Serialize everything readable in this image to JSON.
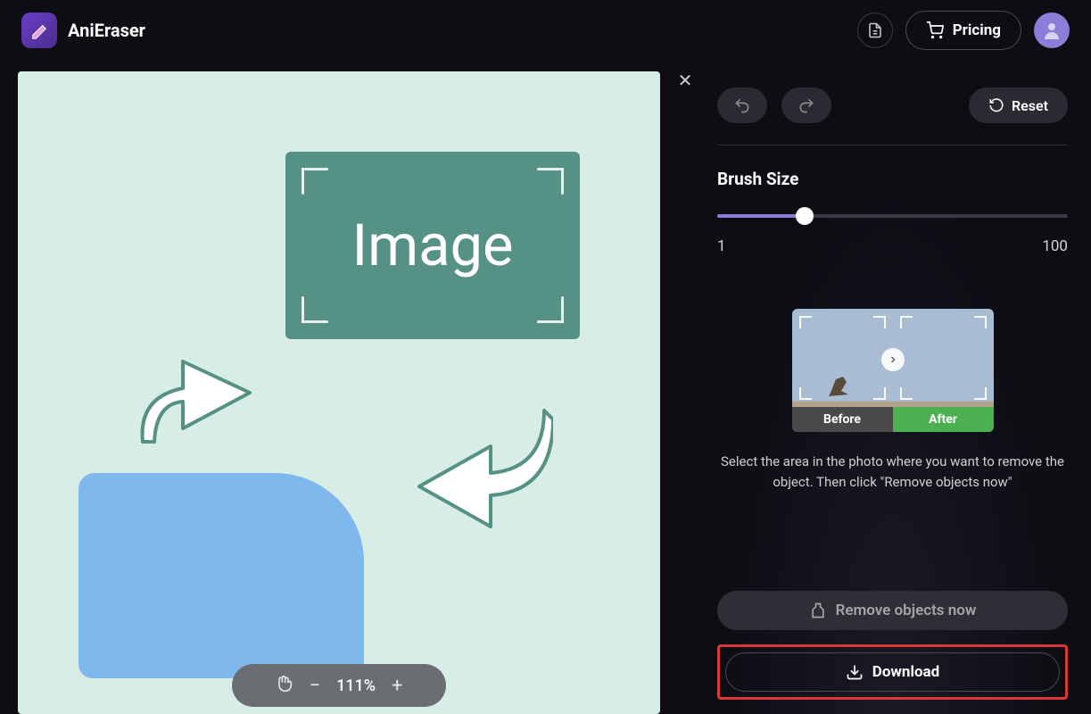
{
  "app": {
    "name": "AniEraser"
  },
  "header": {
    "pricing_label": "Pricing"
  },
  "canvas": {
    "placeholder_text": "Image",
    "zoom": {
      "value": "111%"
    }
  },
  "sidebar": {
    "reset_label": "Reset",
    "brush_label": "Brush Size",
    "brush_min": "1",
    "brush_max": "100",
    "preview": {
      "before_label": "Before",
      "after_label": "After"
    },
    "instruction": "Select the area in the photo where you want to remove the object. Then click \"Remove objects now\"",
    "remove_label": "Remove objects now",
    "download_label": "Download"
  }
}
